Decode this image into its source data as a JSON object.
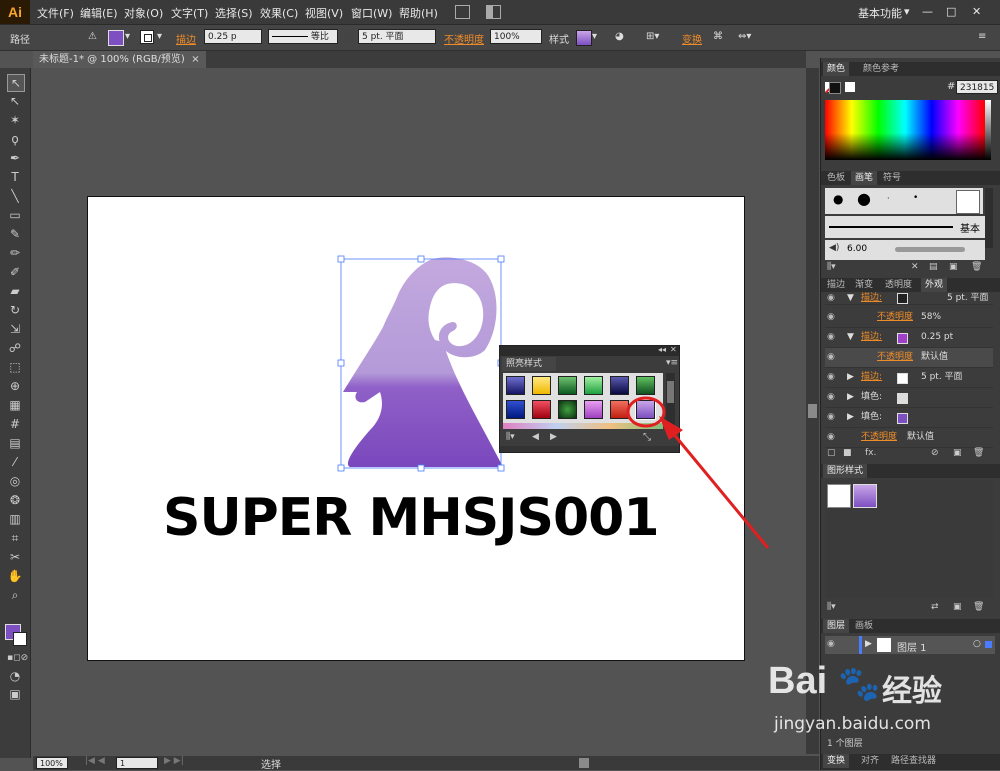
{
  "app": {
    "logo": "Ai",
    "workspace": "基本功能",
    "workspace_arrow": "▾"
  },
  "menu": [
    "文件(F)",
    "编辑(E)",
    "对象(O)",
    "文字(T)",
    "选择(S)",
    "效果(C)",
    "视图(V)",
    "窗口(W)",
    "帮助(H)"
  ],
  "window_controls": {
    "minimize": "—",
    "maximize": "□",
    "close": "✕"
  },
  "control_bar": {
    "object_type": "路径",
    "stroke_label": "描边",
    "stroke_weight": "0.25 p",
    "stroke_profile": "等比",
    "brush": "5 pt. 平面",
    "opacity_label": "不透明度",
    "opacity": "100%",
    "style_label": "样式",
    "transform_label": "变换"
  },
  "document_tab": {
    "title": "未标题-1* @ 100% (RGB/预览)",
    "close": "×"
  },
  "artwork": {
    "text": "SUPER MHSJS001"
  },
  "graphic_style_popup": {
    "title": "照亮样式"
  },
  "color_panel": {
    "tabs": [
      "颜色",
      "颜色参考"
    ],
    "hash": "#",
    "hex": "231815"
  },
  "brush_panel": {
    "tabs": [
      "色板",
      "画笔",
      "符号"
    ],
    "basic_label": "基本",
    "size": "6.00"
  },
  "appearance_panel": {
    "tabs": [
      "描边",
      "渐变",
      "透明度",
      "外观"
    ],
    "rows": [
      {
        "label": "描边:",
        "value": "5 pt. 平面"
      },
      {
        "label": "不透明度",
        "value": "58%"
      },
      {
        "label": "描边:",
        "value": "0.25 pt"
      },
      {
        "label": "不透明度",
        "value": "默认值"
      },
      {
        "label": "描边:",
        "value": "5 pt. 平面"
      },
      {
        "label": "填色:",
        "value": ""
      },
      {
        "label": "填色:",
        "value": ""
      },
      {
        "label": "不透明度",
        "value": "默认值"
      }
    ],
    "fx": "fx."
  },
  "graphic_styles_panel": {
    "title": "图形样式"
  },
  "layers_panel": {
    "tabs": [
      "图层",
      "画板"
    ],
    "layer_name": "图层 1",
    "footer": "1 个图层"
  },
  "bottom_tabs": [
    "变换",
    "对齐",
    "路径查找器"
  ],
  "status": {
    "zoom": "100%",
    "page": "1",
    "tool": "选择"
  },
  "watermark": {
    "brand": "Bai",
    "brand_cn": "经验",
    "url": "jingyan.baidu.com"
  },
  "colors": {
    "accent_orange": "#f08c28",
    "highlight_red": "#e02020",
    "fill_purple": "#7d4fc0",
    "logo_lilac": "#b59ad6"
  }
}
